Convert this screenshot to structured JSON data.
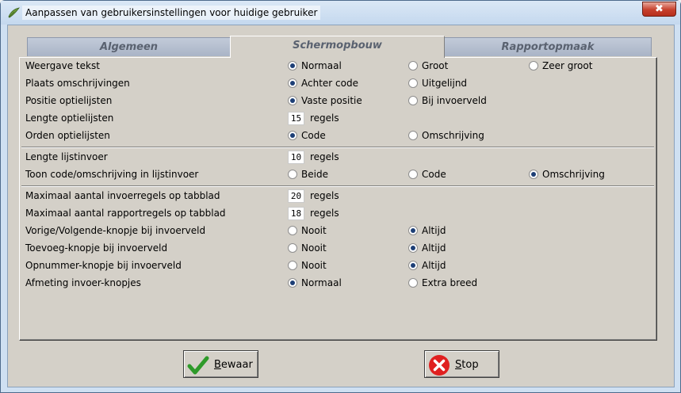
{
  "window": {
    "title": "Aanpassen van gebruikersinstellingen voor huidige gebruiker",
    "close_symbol": "✖"
  },
  "tabs": [
    {
      "label": "Algemeen",
      "active": false
    },
    {
      "label": "Schermopbouw",
      "active": true
    },
    {
      "label": "Rapportopmaak",
      "active": false
    }
  ],
  "settings": {
    "weergave_tekst": {
      "label": "Weergave tekst",
      "options": [
        "Normaal",
        "Groot",
        "Zeer groot"
      ],
      "selected": 0
    },
    "plaats_omschrijvingen": {
      "label": "Plaats omschrijvingen",
      "options": [
        "Achter code",
        "Uitgelijnd"
      ],
      "selected": 0
    },
    "positie_optielijsten": {
      "label": "Positie optielijsten",
      "options": [
        "Vaste positie",
        "Bij invoerveld"
      ],
      "selected": 0
    },
    "lengte_optielijsten": {
      "label": "Lengte optielijsten",
      "value": "15",
      "unit": "regels"
    },
    "orden_optielijsten": {
      "label": "Orden optielijsten",
      "options": [
        "Code",
        "Omschrijving"
      ],
      "selected": 0
    },
    "lengte_lijstinvoer": {
      "label": "Lengte lijstinvoer",
      "value": "10",
      "unit": "regels"
    },
    "toon_code": {
      "label": "Toon code/omschrijving in lijstinvoer",
      "options": [
        "Beide",
        "Code",
        "Omschrijving"
      ],
      "selected": 2
    },
    "max_invoerregels": {
      "label": "Maximaal aantal invoerregels op tabblad",
      "value": "20",
      "unit": "regels"
    },
    "max_rapportregels": {
      "label": "Maximaal aantal rapportregels op tabblad",
      "value": "18",
      "unit": "regels"
    },
    "vorige_volgende": {
      "label": "Vorige/Volgende-knopje bij invoerveld",
      "options": [
        "Nooit",
        "Altijd"
      ],
      "selected": 1
    },
    "toevoeg": {
      "label": "Toevoeg-knopje bij invoerveld",
      "options": [
        "Nooit",
        "Altijd"
      ],
      "selected": 1
    },
    "opnummer": {
      "label": "Opnummer-knopje bij invoerveld",
      "options": [
        "Nooit",
        "Altijd"
      ],
      "selected": 1
    },
    "afmeting": {
      "label": "Afmeting invoer-knopjes",
      "options": [
        "Normaal",
        "Extra breed"
      ],
      "selected": 0
    }
  },
  "buttons": {
    "save_label": "Bewaar",
    "stop_label": "Stop"
  },
  "icons": {
    "title": "app-leaf-icon",
    "save": "checkmark-icon",
    "stop": "red-x-circle-icon"
  },
  "colors": {
    "title_bar": "#cfe0f2",
    "panel_bg": "#d4d0c8",
    "tab_inactive": "#b4bed0",
    "check_green": "#2e9a2a",
    "stop_red": "#e02020"
  }
}
